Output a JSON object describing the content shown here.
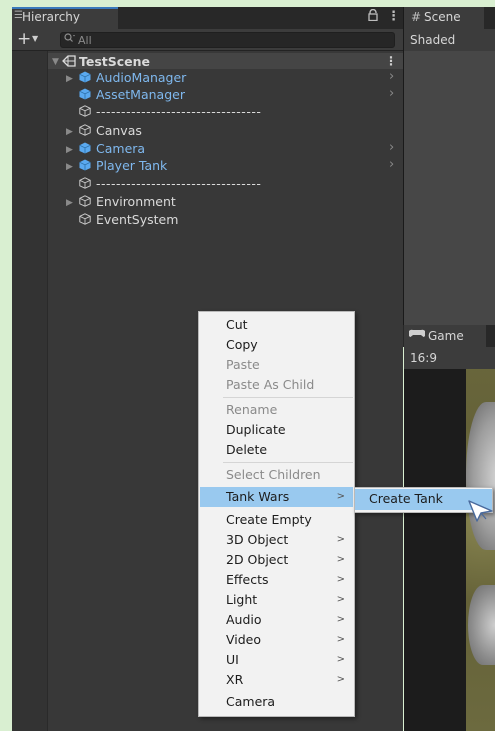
{
  "hierarchy": {
    "tab_label": "Hierarchy",
    "search_placeholder": "All",
    "scene_name": "TestScene",
    "rows": [
      {
        "label": "AudioManager",
        "type": "prefab",
        "has_children": true
      },
      {
        "label": "AssetManager",
        "type": "prefab",
        "has_children": false
      },
      {
        "label": "---------------------------------",
        "type": "separator"
      },
      {
        "label": "Canvas",
        "type": "plain",
        "has_children": true
      },
      {
        "label": "Camera",
        "type": "prefab",
        "has_children": true
      },
      {
        "label": "Player Tank",
        "type": "prefab",
        "has_children": true
      },
      {
        "label": "---------------------------------",
        "type": "separator"
      },
      {
        "label": "Environment",
        "type": "plain",
        "has_children": true
      },
      {
        "label": "EventSystem",
        "type": "plain",
        "has_children": false
      }
    ]
  },
  "scene_view": {
    "tab_label": "Scene",
    "shading_label": "Shaded"
  },
  "game_view": {
    "tab_label": "Game",
    "aspect_label": "16:9"
  },
  "context_menu": {
    "items": [
      {
        "label": "Cut",
        "enabled": true
      },
      {
        "label": "Copy",
        "enabled": true
      },
      {
        "label": "Paste",
        "enabled": false
      },
      {
        "label": "Paste As Child",
        "enabled": false
      },
      {
        "label": "Rename",
        "enabled": false
      },
      {
        "label": "Duplicate",
        "enabled": true
      },
      {
        "label": "Delete",
        "enabled": true
      },
      {
        "label": "Select Children",
        "enabled": false
      },
      {
        "label": "Tank Wars",
        "enabled": true,
        "submenu": true,
        "highlighted": true
      },
      {
        "label": "Create Empty",
        "enabled": true
      },
      {
        "label": "3D Object",
        "enabled": true,
        "submenu": true
      },
      {
        "label": "2D Object",
        "enabled": true,
        "submenu": true
      },
      {
        "label": "Effects",
        "enabled": true,
        "submenu": true
      },
      {
        "label": "Light",
        "enabled": true,
        "submenu": true
      },
      {
        "label": "Audio",
        "enabled": true,
        "submenu": true
      },
      {
        "label": "Video",
        "enabled": true,
        "submenu": true
      },
      {
        "label": "UI",
        "enabled": true,
        "submenu": true
      },
      {
        "label": "XR",
        "enabled": true,
        "submenu": true
      },
      {
        "label": "Camera",
        "enabled": true
      }
    ],
    "submenu_item": "Create Tank"
  },
  "colors": {
    "prefab_text": "#7fb8ee",
    "highlight": "#99c9ef",
    "tab_accent": "#3a79bb"
  }
}
